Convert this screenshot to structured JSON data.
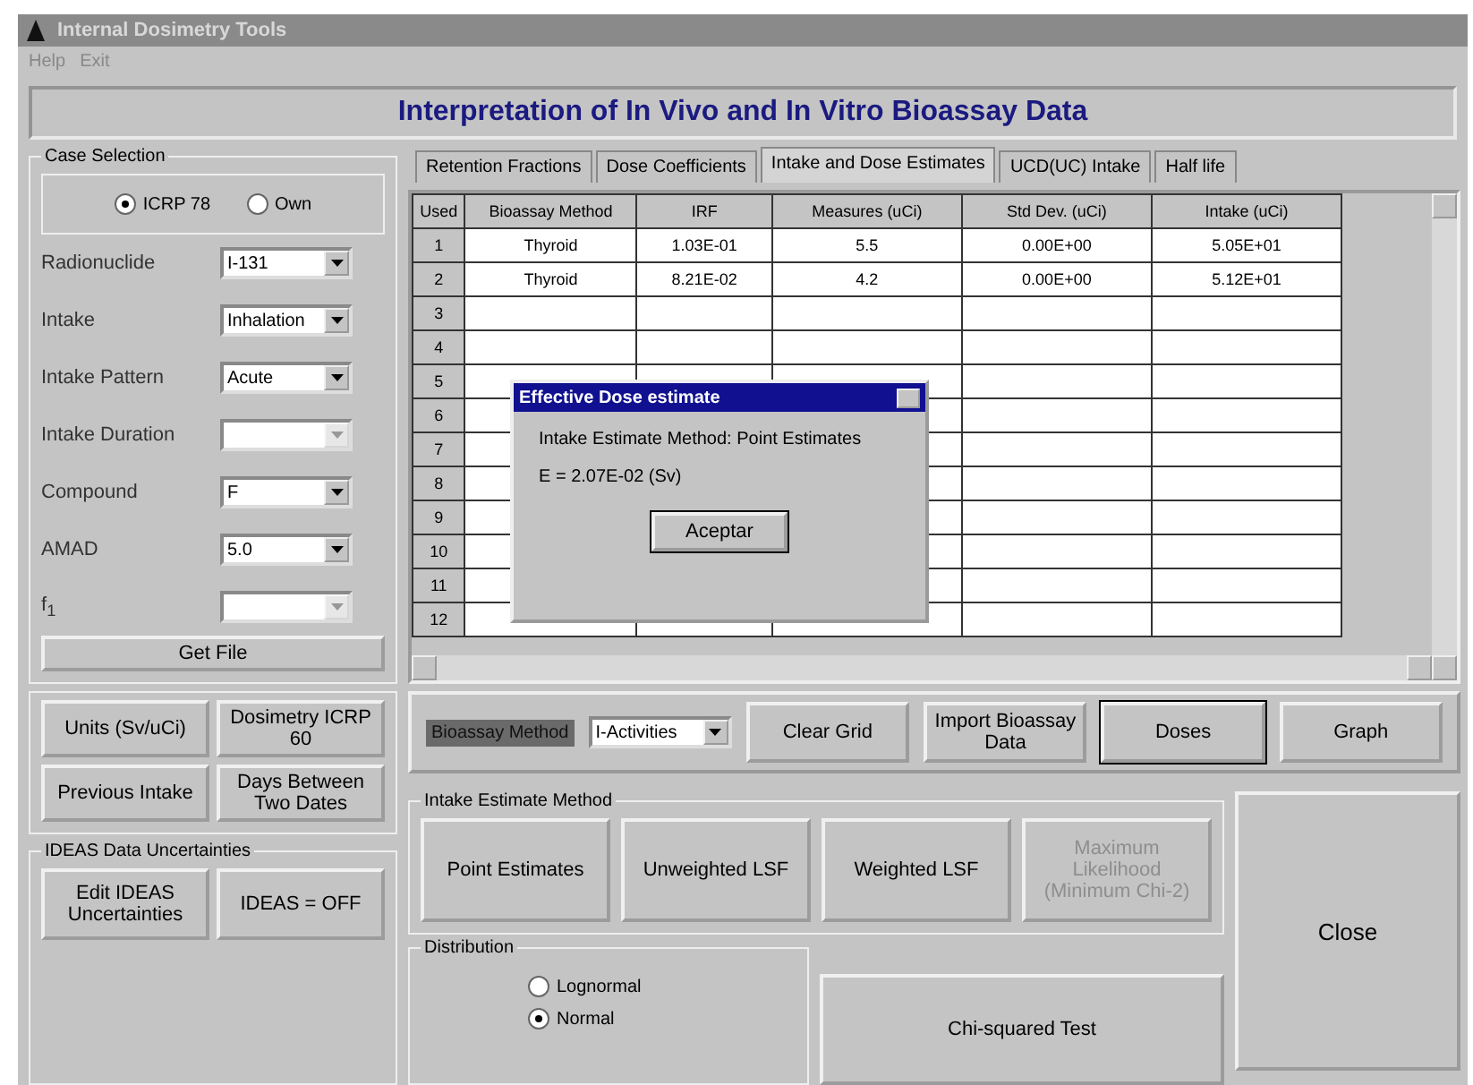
{
  "window": {
    "title": "Internal Dosimetry Tools",
    "menu": [
      "Help",
      "Exit"
    ]
  },
  "header": {
    "title": "Interpretation of In Vivo and In Vitro Bioassay Data"
  },
  "case_selection": {
    "label": "Case Selection",
    "options": [
      {
        "label": "ICRP 78",
        "selected": true
      },
      {
        "label": "Own",
        "selected": false
      }
    ]
  },
  "fields": [
    {
      "label": "Radionuclide",
      "value": "I-131",
      "disabled": false
    },
    {
      "label": "Intake",
      "value": "Inhalation",
      "disabled": false
    },
    {
      "label": "Intake Pattern",
      "value": "Acute",
      "disabled": false
    },
    {
      "label": "Intake Duration",
      "disabled": true
    },
    {
      "label": "Compound",
      "value": "F",
      "disabled": false
    },
    {
      "label": "AMAD",
      "value": "5.0",
      "disabled": false
    },
    {
      "label": "f$_{1}$",
      "disabled": true
    }
  ],
  "get_file_button": "Get File",
  "tool_buttons": [
    "Units (Sv/uCi)",
    "Dosimetry ICRP 60",
    "Previous Intake",
    "Days Between Two Dates"
  ],
  "ideas": {
    "label": "IDEAS Data Uncertainties",
    "buttons": [
      "Edit IDEAS Uncertainties",
      "IDEAS = OFF"
    ]
  },
  "tabs": [
    {
      "label": "Retention Fractions",
      "selected": false
    },
    {
      "label": "Dose Coefficients",
      "selected": false
    },
    {
      "label": "Intake and Dose Estimates",
      "selected": true
    },
    {
      "label": "UCD(UC) Intake",
      "selected": false
    },
    {
      "label": "Half life",
      "selected": false
    }
  ],
  "table": {
    "columns": [
      "Used",
      "Bioassay Method",
      "IRF",
      "Measures (uCi)",
      "Std Dev. (uCi)",
      "Intake (uCi)"
    ],
    "rows": [
      [
        "1",
        "Thyroid",
        "1.03E-01",
        "5.5",
        "0.00E+00",
        "5.05E+01"
      ],
      [
        "2",
        "Thyroid",
        "8.21E-02",
        "4.2",
        "0.00E+00",
        "5.12E+01"
      ],
      [
        "3"
      ],
      [
        "4"
      ],
      [
        "5"
      ],
      [
        "6"
      ],
      [
        "7"
      ],
      [
        "8"
      ],
      [
        "9"
      ],
      [
        "10"
      ],
      [
        "11"
      ],
      [
        "12"
      ]
    ]
  },
  "bioassay_method": {
    "label": "Bioassay Method",
    "value": "I-Activities"
  },
  "grid_buttons": [
    {
      "label": "Clear Grid",
      "focused": false
    },
    {
      "label": "Import Bioassay Data",
      "focused": false
    },
    {
      "label": "Doses",
      "focused": true
    },
    {
      "label": "Graph",
      "focused": false
    }
  ],
  "intake_method": {
    "label": "Intake Estimate Method",
    "buttons": [
      {
        "label": "Point Estimates",
        "disabled": false
      },
      {
        "label": "Unweighted LSF",
        "disabled": false
      },
      {
        "label": "Weighted LSF",
        "disabled": false
      },
      {
        "label": "Maximum Likelihood (Minimum Chi-2)",
        "disabled": true
      }
    ]
  },
  "distribution": {
    "label": "Distribution",
    "options": [
      {
        "label": "Lognormal",
        "selected": false
      },
      {
        "label": "Normal",
        "selected": true
      }
    ]
  },
  "chi_button": "Chi-squared Test",
  "close_button": "Close",
  "dialog": {
    "title": "Effective Dose estimate",
    "lines": [
      "Intake Estimate Method: Point Estimates",
      "E = 2.07E-02 (Sv)"
    ],
    "button": "Aceptar"
  }
}
